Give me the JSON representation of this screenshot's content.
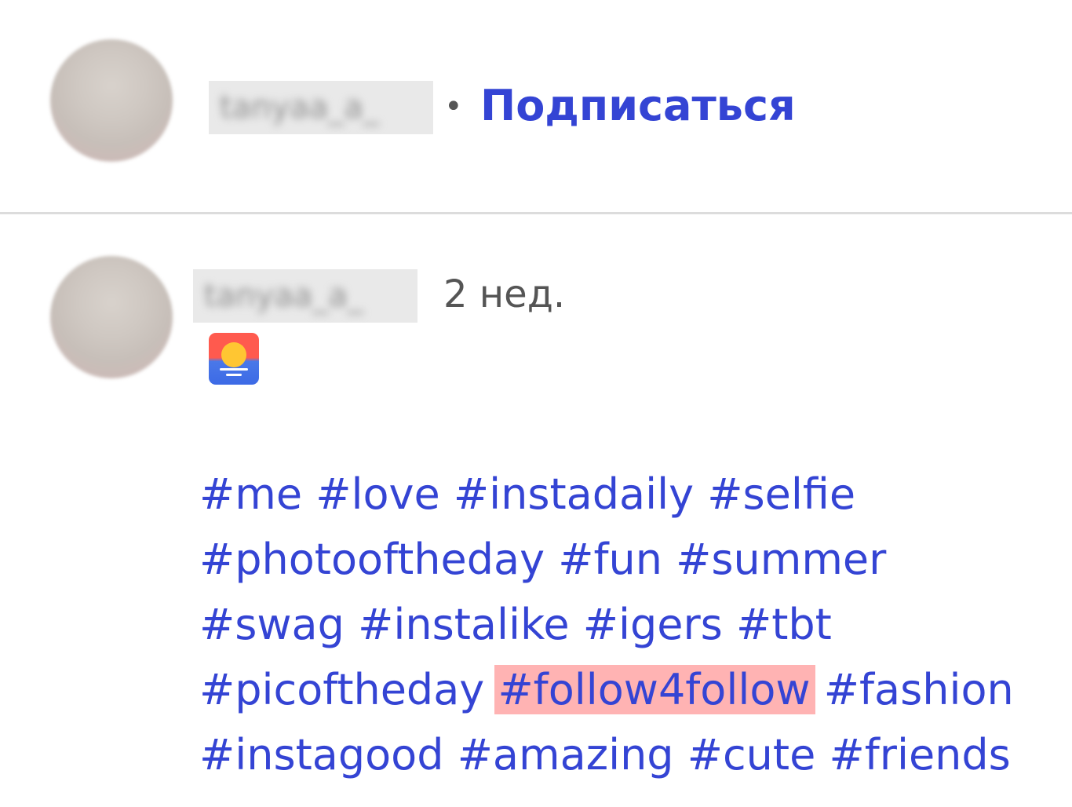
{
  "header": {
    "username": "tanyaa_a_",
    "separator": "•",
    "follow_label": "Подписаться"
  },
  "comment": {
    "username": "tanyaa_a_",
    "time": "2 нед.",
    "icon": "sunrise-app-icon",
    "hashtag_lines": [
      [
        "#me",
        "#love",
        "#instadaily",
        "#selfie"
      ],
      [
        "#photooftheday",
        "#fun",
        "#summer"
      ],
      [
        "#swag",
        "#instalike",
        "#igers",
        "#tbt"
      ],
      [
        "#picoftheday",
        "#follow4follow",
        "#fashion"
      ],
      [
        "#instagood",
        "#amazing",
        "#cute",
        "#friends"
      ]
    ],
    "highlighted_tag": "#follow4follow"
  },
  "colors": {
    "link": "#3444d4",
    "highlight": "#ffb3b3",
    "divider": "#dcdcdc",
    "muted_text": "#555555"
  }
}
